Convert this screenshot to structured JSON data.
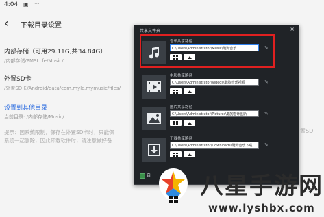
{
  "status": {
    "time": "4:04"
  },
  "header": {
    "title": "下载目录设置"
  },
  "storage": [
    {
      "name": "内部存储（可用29.11G,共34.84G）",
      "path": "/内部存储/PMSLLfe/Music/"
    },
    {
      "name": "外置SD卡",
      "path": "/外置SD卡/Android/data/com.mylc.mymusic/files/"
    }
  ],
  "other_link": "设置到其他目录",
  "current_dir": "当前目录: /内部存储/Music/",
  "hint_line1": "提示：因系统限制，保存在外置SD卡时，只能保",
  "hint_line2": "系统一起删除，因此卸载软件时，请注意做好备",
  "right_text": "外置SD",
  "dialog": {
    "title": "共享文件夹",
    "close": "×",
    "rows": [
      {
        "label": "音乐共享路径",
        "path": "C:\\Users\\Administrator\\Music\\酷狗音乐",
        "icon": "music-note-icon"
      },
      {
        "label": "电影共享路径",
        "path": "C:\\Users\\Administrator\\Videos\\酷狗音乐视频",
        "icon": "film-icon"
      },
      {
        "label": "图片共享路径",
        "path": "C:\\Users\\Administrator\\Pictures\\酷狗音乐图片",
        "icon": "picture-icon"
      },
      {
        "label": "下载共享路径",
        "path": "C:\\Users\\Administrator\\Downloads\\酷狗音乐下载",
        "icon": "download-icon"
      }
    ],
    "footer_text": "自"
  },
  "watermark": {
    "text": "八星手游网",
    "url": "www.lyshbx.com"
  },
  "colors": {
    "highlight": "#e02020",
    "link": "#2a6be0",
    "dialog_bg": "#202327"
  }
}
